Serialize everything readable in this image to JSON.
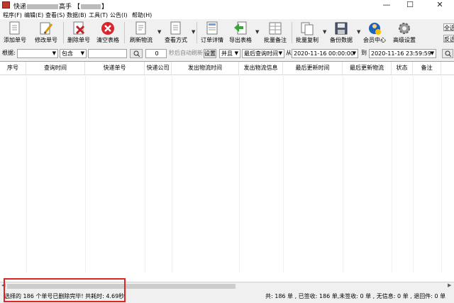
{
  "window": {
    "title_prefix": "快",
    "title_mid": "递",
    "title_suffix": "高手",
    "title_bracket_open": "【",
    "title_bracket_close": "】",
    "minimize": "—",
    "maximize": "☐",
    "close": "✕"
  },
  "menu": [
    {
      "label": "程序(F)"
    },
    {
      "label": "编辑(E)"
    },
    {
      "label": "查看(S)"
    },
    {
      "label": "数据(B)"
    },
    {
      "label": "工具(T)"
    },
    {
      "label": "公告(I)"
    },
    {
      "label": "帮助(H)"
    }
  ],
  "toolbar": {
    "add": "添加单号",
    "edit": "修改单号",
    "delete": "删除单号",
    "clear": "清空表格",
    "refresh": "刷新物流",
    "view_mode": "查看方式",
    "order_detail": "订单详情",
    "export": "导出表格",
    "batch_note": "批量备注",
    "batch_copy": "批量复制",
    "backup": "备份数据",
    "member": "会员中心",
    "advanced": "高级设置",
    "side_btn_1": "全选",
    "side_btn_2": "反选"
  },
  "filter": {
    "by_label": "根据:",
    "by_value": "",
    "contains_value": "包含",
    "keyword": "",
    "seconds_value": "0",
    "auto_refresh_label": "秒后自动刷新",
    "settings": "设置",
    "and_value": "并且",
    "time_field": "最后查询时间",
    "from_label": "从",
    "from_date": "2020-11-16 00:00:00",
    "to_label": "到",
    "to_date": "2020-11-16 23:59:59"
  },
  "table": {
    "columns": [
      "序号",
      "查询时间",
      "快递单号",
      "快递公司",
      "发出物流时间",
      "发出物流信息",
      "最后更新时间",
      "最后更新物流",
      "状态",
      "备注"
    ],
    "rows": []
  },
  "status": {
    "message": "选择的 186 个单号已删除完毕! 共耗时: 4.69秒",
    "summary": "共: 186 单 , 已签收: 186 单,未签收: 0 单 , 无信息: 0 单 , 退回件: 0 单"
  },
  "colors": {
    "highlight_border": "#e02424"
  }
}
